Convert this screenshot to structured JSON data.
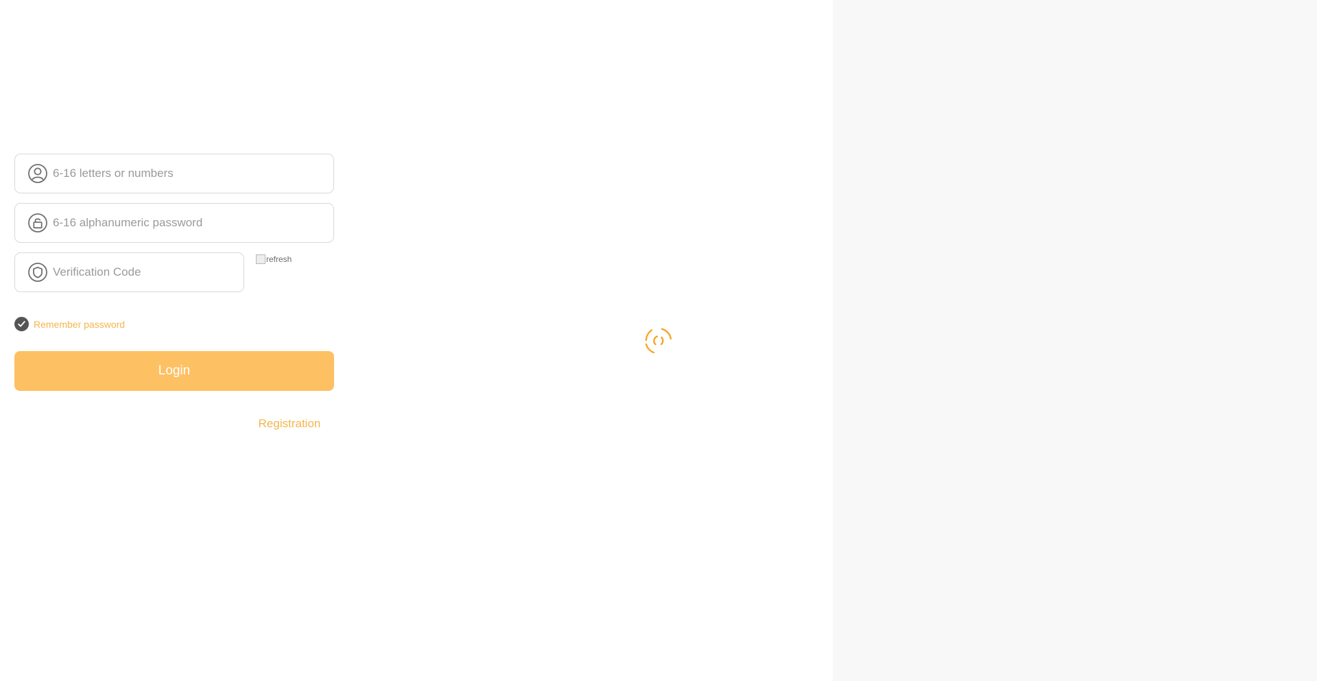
{
  "login": {
    "username": {
      "placeholder": "6-16 letters or numbers",
      "value": "",
      "icon": "user-icon"
    },
    "password": {
      "placeholder": "6-16 alphanumeric password",
      "value": "",
      "icon": "lock-icon"
    },
    "code": {
      "placeholder": "Verification Code",
      "value": "",
      "icon": "shield-icon"
    },
    "captcha_alt": "refresh",
    "remember_label": "Remember password",
    "remember_checked": true,
    "login_label": "Login",
    "register_label": "Registration"
  },
  "colors": {
    "accent": "#fdc063",
    "accent_text": "#f5b54c",
    "spinner": "#f5a623",
    "check_bg": "#555555",
    "right_pane_bg": "#f8f8f8"
  }
}
